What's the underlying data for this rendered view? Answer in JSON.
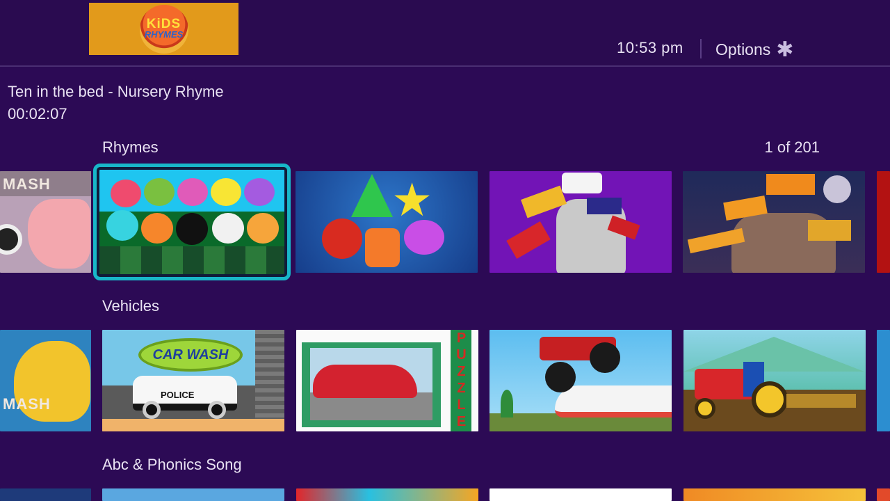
{
  "header": {
    "logo_line1": "KiDS",
    "logo_line2": "RHYMES",
    "time": "10:53  pm",
    "options_label": "Options",
    "options_icon": "asterisk-icon"
  },
  "now_playing": {
    "title": "Ten in the bed - Nursery Rhyme",
    "elapsed": "00:02:07"
  },
  "rows": [
    {
      "label": "Rhymes",
      "counter": "1 of 201",
      "tiles": [
        {
          "caption": "MASH"
        },
        {
          "caption": ""
        },
        {
          "caption": ""
        },
        {
          "caption": ""
        },
        {
          "caption": ""
        }
      ]
    },
    {
      "label": "Vehicles",
      "tiles": [
        {
          "caption": "MASH"
        },
        {
          "caption": "CAR WASH",
          "sign": "POLICE"
        },
        {
          "caption": "PUZZLE"
        },
        {
          "caption": ""
        },
        {
          "caption": ""
        }
      ]
    },
    {
      "label": "Abc & Phonics Song"
    }
  ],
  "colors": {
    "background": "#2c0a55",
    "focus_ring": "#18b7c9",
    "logo_bg": "#e29a1b"
  }
}
